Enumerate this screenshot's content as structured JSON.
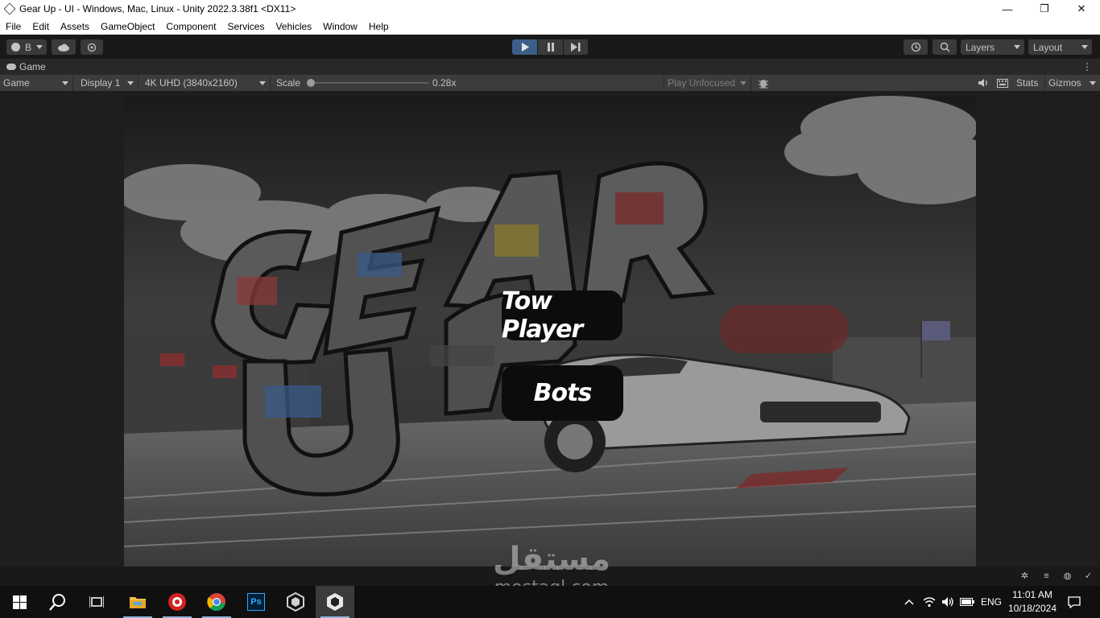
{
  "window": {
    "title": "Gear Up - UI - Windows, Mac, Linux - Unity 2022.3.38f1 <DX11>",
    "minimize": "—",
    "restore": "❐",
    "close": "✕"
  },
  "menubar": {
    "items": [
      "File",
      "Edit",
      "Assets",
      "GameObject",
      "Component",
      "Services",
      "Vehicles",
      "Window",
      "Help"
    ]
  },
  "toolbar": {
    "account_label": "B",
    "layers_label": "Layers",
    "layout_label": "Layout",
    "accent_color": "#3c5f8a"
  },
  "game_tab": {
    "label": "Game",
    "menu": "⋮"
  },
  "game_view": {
    "view_mode": "Game",
    "display": "Display 1",
    "resolution": "4K UHD (3840x2160)",
    "scale_label": "Scale",
    "scale_value": "0.28x",
    "play_mode": "Play Unfocused",
    "stats_label": "Stats",
    "gizmos_label": "Gizmos"
  },
  "game": {
    "buttons": {
      "two_player": "Tow Player",
      "bots": "Bots"
    }
  },
  "watermark": {
    "arabic": "مستقل",
    "latin": "mostaql.com"
  },
  "taskbar": {
    "language": "ENG",
    "time": "11:01 AM",
    "date": "10/18/2024",
    "ps_label": "Ps"
  }
}
